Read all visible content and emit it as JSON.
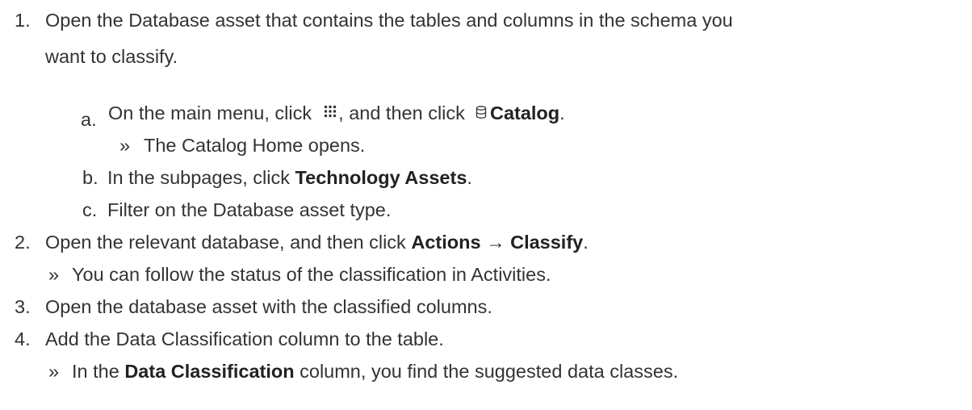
{
  "steps": [
    {
      "number": "1.",
      "text_line1": "Open the Database asset that contains the tables and columns in the schema you",
      "text_line2": "want to classify.",
      "substeps": [
        {
          "letter": "a.",
          "text_before": "On the main menu, click",
          "icon1": "apps-grid-icon",
          "text_middle": ", and then click",
          "icon2": "database-icon",
          "bold": "Catalog",
          "text_after": ".",
          "result": "The Catalog Home opens."
        },
        {
          "letter": "b.",
          "text_before": "In the subpages, click",
          "bold": "Technology Assets",
          "text_after": "."
        },
        {
          "letter": "c.",
          "text": "Filter on the Database asset type."
        }
      ]
    },
    {
      "number": "2.",
      "text_before": "Open the relevant database, and then click",
      "bold1": "Actions",
      "arrow": "→",
      "bold2": "Classify",
      "text_after": ".",
      "result": "You can follow the status of the classification in Activities."
    },
    {
      "number": "3.",
      "text": "Open the database asset with the classified columns."
    },
    {
      "number": "4.",
      "text": "Add the Data Classification column to the table.",
      "result_before": "In the",
      "result_bold": "Data Classification",
      "result_after": "column, you find the suggested data classes."
    }
  ],
  "result_marker": "»",
  "colors": {
    "text": "#333333",
    "bold_text": "#222222"
  }
}
